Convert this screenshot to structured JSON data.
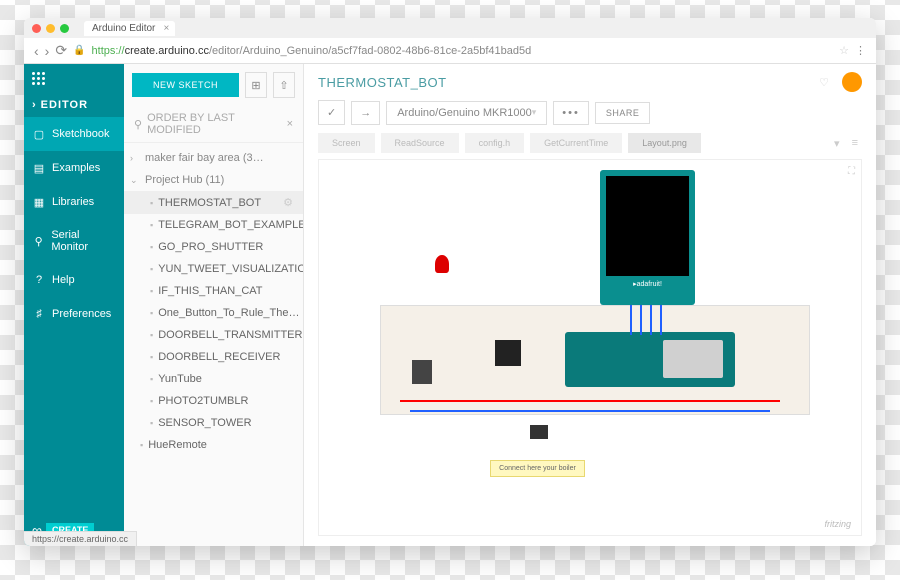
{
  "browser": {
    "tab_title": "Arduino Editor",
    "url_proto": "https://",
    "url_host": "create.arduino.cc",
    "url_path": "/editor/Arduino_Genuino/a5cf7fad-0802-48b6-81ce-2a5bf41bad5d",
    "status_url": "https://create.arduino.cc"
  },
  "sidebar": {
    "title": "EDITOR",
    "items": [
      {
        "label": "Sketchbook"
      },
      {
        "label": "Examples"
      },
      {
        "label": "Libraries"
      },
      {
        "label": "Serial Monitor"
      },
      {
        "label": "Help"
      },
      {
        "label": "Preferences"
      }
    ],
    "create_label": "CREATE"
  },
  "filepane": {
    "new_sketch_label": "NEW SKETCH",
    "search_placeholder": "ORDER BY LAST MODIFIED",
    "folders": [
      {
        "label": "maker fair bay area (3…",
        "expanded": false
      },
      {
        "label": "Project Hub (11)",
        "expanded": true
      }
    ],
    "files": [
      "THERMOSTAT_BOT",
      "TELEGRAM_BOT_EXAMPLE_L…",
      "GO_PRO_SHUTTER",
      "YUN_TWEET_VISUALIZATIO…",
      "IF_THIS_THAN_CAT",
      "One_Button_To_Rule_The…",
      "DOORBELL_TRANSMITTER",
      "DOORBELL_RECEIVER",
      "YunTube",
      "PHOTO2TUMBLR",
      "SENSOR_TOWER"
    ],
    "extra_file": "HueRemote"
  },
  "main": {
    "project_title": "THERMOSTAT_BOT",
    "board": "Arduino/Genuino MKR1000",
    "share_label": "SHARE",
    "tabs": [
      "Screen",
      "ReadSource",
      "config.h",
      "GetCurrentTime"
    ],
    "image_tab": "Layout.png",
    "note_text": "Connect here your boiler",
    "fritzing": "fritzing"
  }
}
